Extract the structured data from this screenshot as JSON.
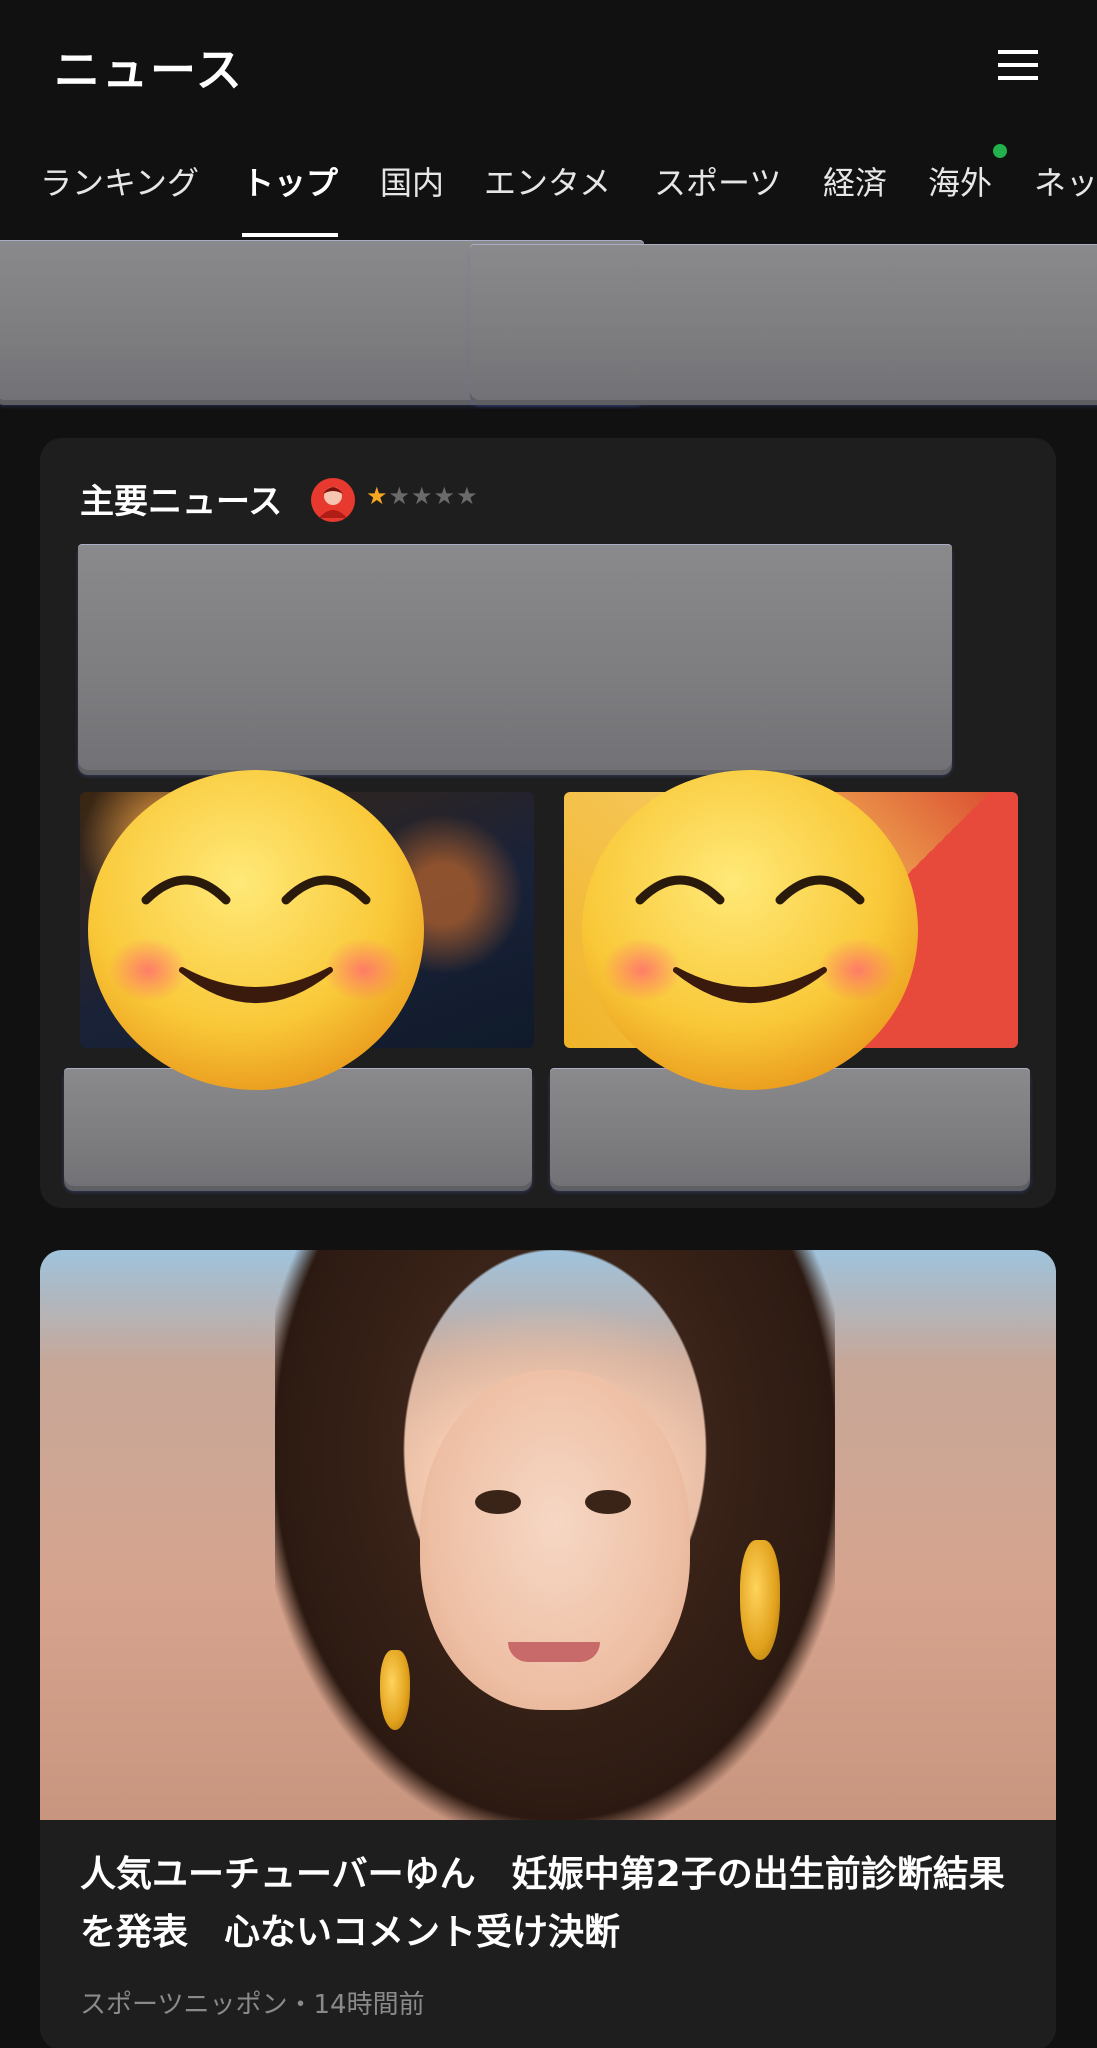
{
  "header": {
    "title": "ニュース",
    "menu_icon": "hamburger-menu-icon"
  },
  "tabs": [
    {
      "label": "ランキング",
      "active": false
    },
    {
      "label": "トップ",
      "active": true
    },
    {
      "label": "国内",
      "active": false
    },
    {
      "label": "エンタメ",
      "active": false
    },
    {
      "label": "スポーツ",
      "active": false
    },
    {
      "label": "経済",
      "active": false
    },
    {
      "label": "海外",
      "active": false,
      "badge_dot": true
    },
    {
      "label": "ネッ",
      "active": false
    }
  ],
  "main_news": {
    "title": "主要ニュース",
    "rating": {
      "filled": 1,
      "total": 5
    },
    "colors": {
      "star_on": "#f5a623",
      "star_off": "#6a6a6a",
      "avatar": "#e8392f"
    }
  },
  "featured": {
    "headline": "人気ユーチューバーゆん　妊娠中第2子の出生前診断結果を発表　心ないコメント受け決断",
    "source": "スポーツニッポン",
    "time": "14時間前",
    "meta": "スポーツニッポン・14時間前"
  },
  "colors": {
    "background": "#111111",
    "card": "#1e1e1e",
    "notification_dot": "#22b14c"
  }
}
